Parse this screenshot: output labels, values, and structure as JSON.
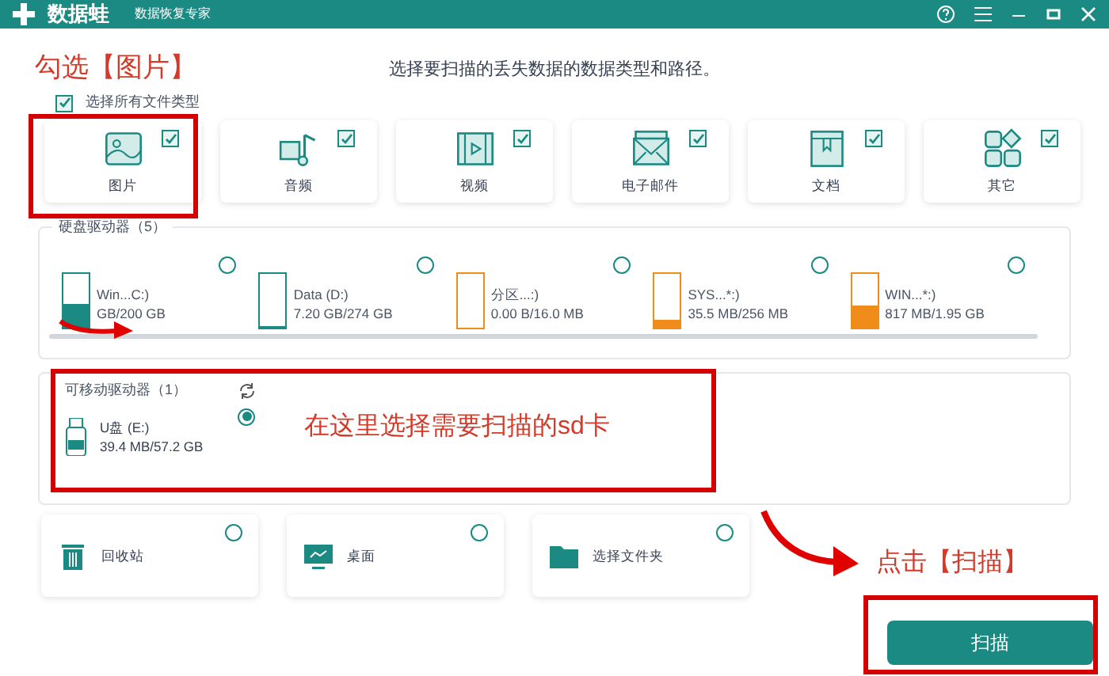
{
  "window": {
    "logo": "数据蛙",
    "subtitle": "数据恢复专家"
  },
  "heading": "选择要扫描的丢失数据的数据类型和路径。",
  "select_all": {
    "label": "选择所有文件类型",
    "checked": true
  },
  "file_types": [
    {
      "label": "图片",
      "kind": "image",
      "checked": true
    },
    {
      "label": "音频",
      "kind": "audio",
      "checked": true
    },
    {
      "label": "视频",
      "kind": "video",
      "checked": true
    },
    {
      "label": "电子邮件",
      "kind": "mail",
      "checked": true
    },
    {
      "label": "文档",
      "kind": "doc",
      "checked": true
    },
    {
      "label": "其它",
      "kind": "other",
      "checked": true
    }
  ],
  "hard_drives": {
    "title": "硬盘驱动器（5）",
    "drives": [
      {
        "name": "Win...C:)",
        "size": "GB/200 GB",
        "level": 0.45,
        "color": "#1a8a82",
        "selected": false
      },
      {
        "name": "Data (D:)",
        "size": "7.20 GB/274 GB",
        "level": 0.03,
        "color": "#1a8a82",
        "selected": false
      },
      {
        "name": "分区...:)",
        "size": "0.00  B/16.0 MB",
        "level": 0,
        "color": "#f08c1a",
        "selected": false
      },
      {
        "name": "SYS...*:)",
        "size": "35.5 MB/256 MB",
        "level": 0.14,
        "color": "#f08c1a",
        "selected": false
      },
      {
        "name": "WIN...*:)",
        "size": "817 MB/1.95 GB",
        "level": 0.42,
        "color": "#f08c1a",
        "selected": false
      }
    ]
  },
  "removable": {
    "title": "可移动驱动器（1）",
    "drives": [
      {
        "name": "U盘 (E:)",
        "size": "39.4 MB/57.2 GB",
        "selected": true
      }
    ]
  },
  "locations": [
    {
      "label": "回收站",
      "kind": "trash",
      "selected": false
    },
    {
      "label": "桌面",
      "kind": "desktop",
      "selected": false
    },
    {
      "label": "选择文件夹",
      "kind": "folder",
      "selected": false
    }
  ],
  "scan_button": "扫描",
  "annotations": [
    "勾选【图片】",
    "在这里选择需要扫描的sd卡",
    "点击【扫描】"
  ]
}
